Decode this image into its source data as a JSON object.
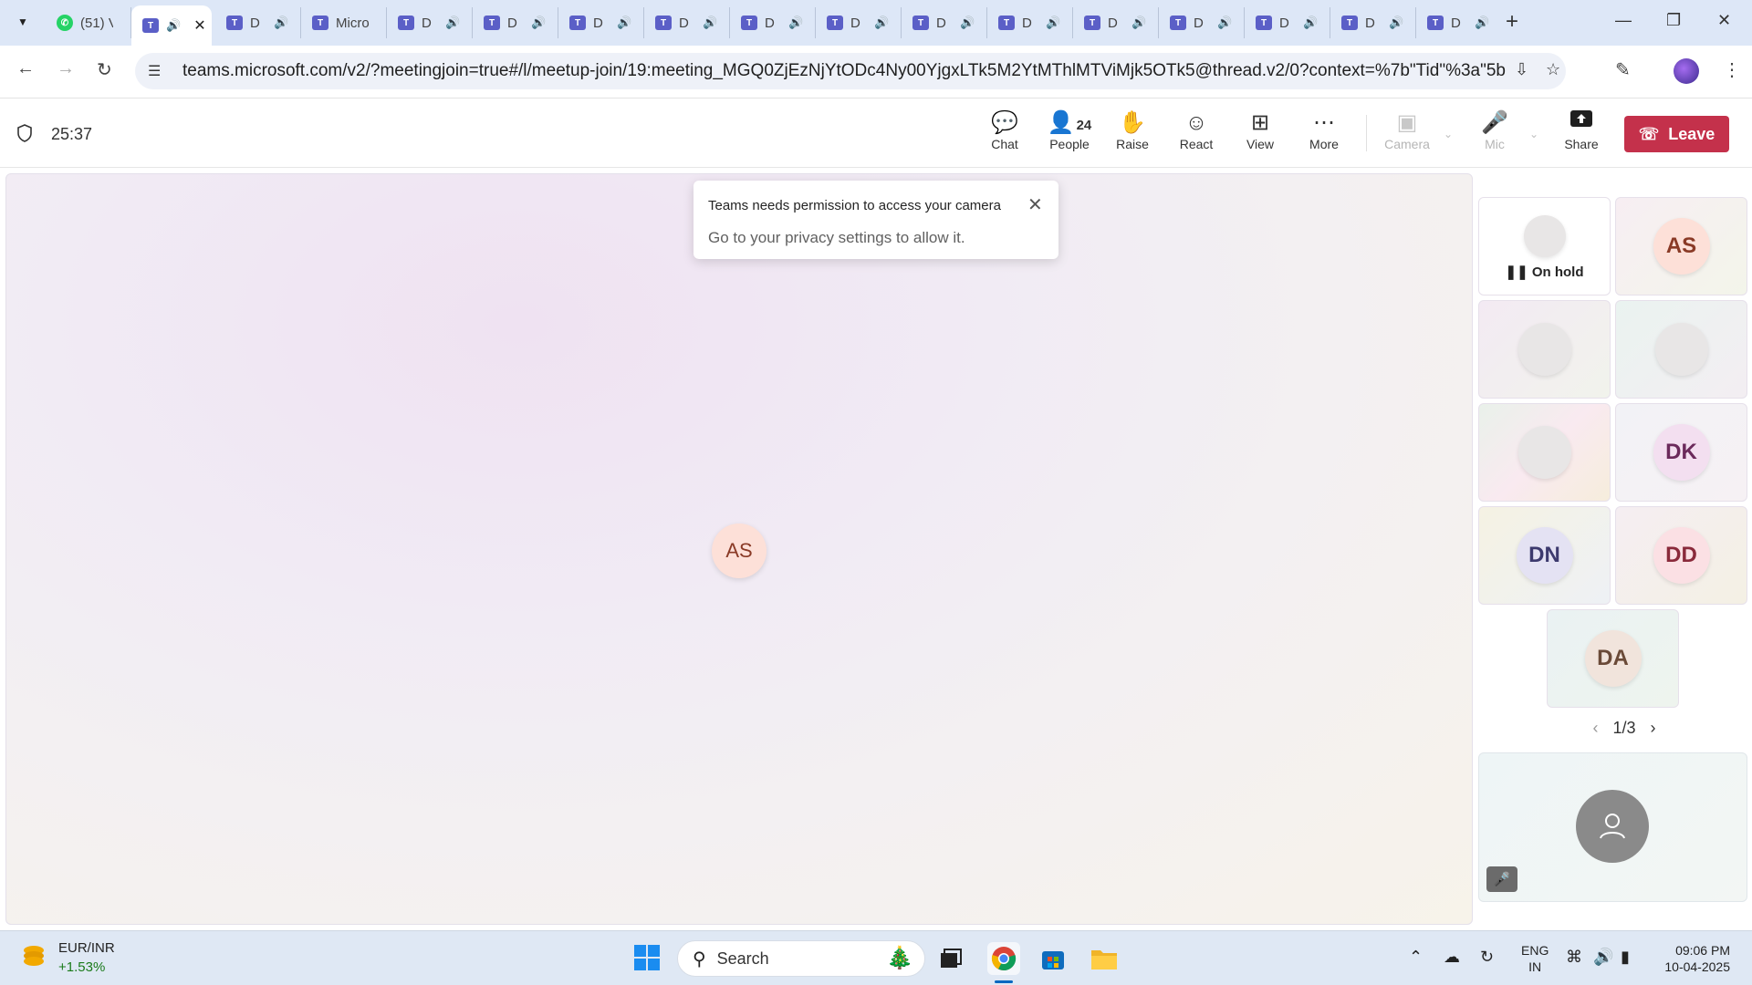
{
  "browser": {
    "tabs": [
      {
        "title": "(51) V",
        "favicon": "whatsapp-icon",
        "badge": "51"
      },
      {
        "title": "",
        "favicon": "teams-icon",
        "audio": true,
        "active": true
      },
      {
        "title": "D",
        "favicon": "teams-icon",
        "audio": true
      },
      {
        "title": "Micro",
        "favicon": "teams-icon",
        "audio": false
      },
      {
        "title": "D",
        "favicon": "teams-icon",
        "audio": true
      },
      {
        "title": "D",
        "favicon": "teams-icon",
        "audio": true
      },
      {
        "title": "D",
        "favicon": "teams-icon",
        "audio": true
      },
      {
        "title": "D",
        "favicon": "teams-icon",
        "audio": true
      },
      {
        "title": "D",
        "favicon": "teams-icon",
        "audio": true
      },
      {
        "title": "D",
        "favicon": "teams-icon",
        "audio": true
      },
      {
        "title": "D",
        "favicon": "teams-icon",
        "audio": true
      },
      {
        "title": "D",
        "favicon": "teams-icon",
        "audio": true
      },
      {
        "title": "D",
        "favicon": "teams-icon",
        "audio": true
      },
      {
        "title": "D",
        "favicon": "teams-icon",
        "audio": true
      },
      {
        "title": "D",
        "favicon": "teams-icon",
        "audio": true
      },
      {
        "title": "D",
        "favicon": "teams-icon",
        "audio": true
      },
      {
        "title": "D",
        "favicon": "teams-icon",
        "audio": true
      }
    ],
    "url": "teams.microsoft.com/v2/?meetingjoin=true#/l/meetup-join/19:meeting_MGQ0ZjEzNjYtODc4Ny00YjgxLTk5M2YtMThlMTViMjk5OTk5@thread.v2/0?context=%7b\"Tid\"%3a\"5b268d57-2a6f-"
  },
  "meeting": {
    "timer": "25:37",
    "toolbar": {
      "chat": "Chat",
      "people": "People",
      "people_count": "24",
      "raise": "Raise",
      "react": "React",
      "view": "View",
      "more": "More",
      "camera": "Camera",
      "mic": "Mic",
      "share": "Share",
      "leave": "Leave"
    },
    "stage_initials": "AS",
    "toast": {
      "title": "Teams needs permission to access your camera",
      "body": "Go to your privacy settings to allow it."
    },
    "tiles": {
      "t1_status": "On hold",
      "t2": "AS",
      "t6": "DK",
      "t7": "DN",
      "t8": "DD",
      "t9": "DA"
    },
    "pager": "1/3"
  },
  "taskbar": {
    "widget_name": "EUR/INR",
    "widget_value": "+1.53%",
    "search": "Search",
    "lang1": "ENG",
    "lang2": "IN",
    "time": "09:06 PM",
    "date": "10-04-2025"
  },
  "colors": {
    "leave": "#c4314b",
    "teams": "#5b5fc7",
    "accent": "#0067c0"
  }
}
